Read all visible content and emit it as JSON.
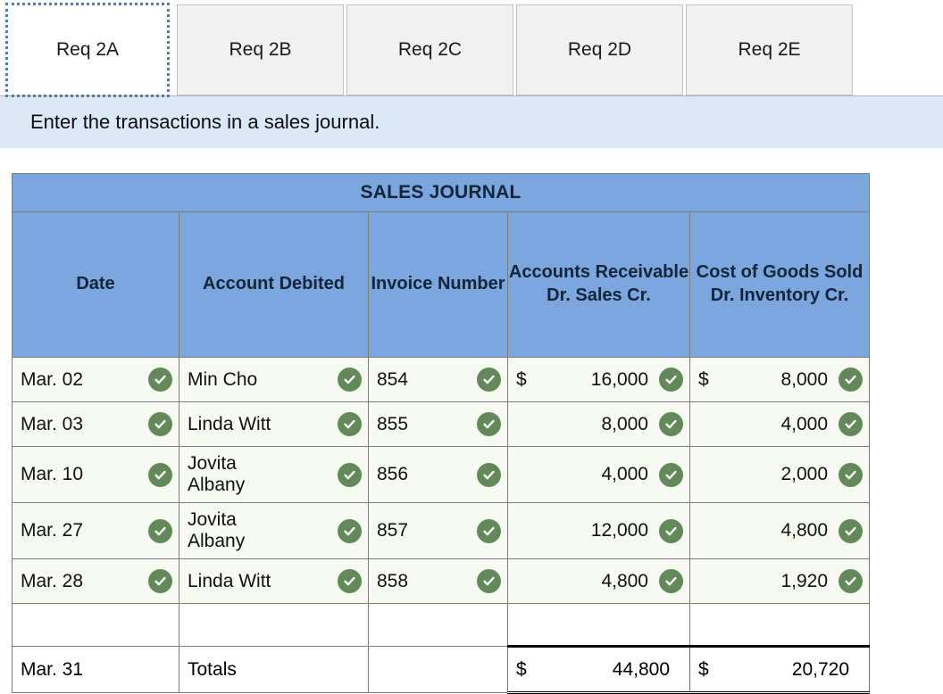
{
  "tabs": [
    {
      "label": "Req 2A",
      "active": true
    },
    {
      "label": "Req 2B",
      "active": false
    },
    {
      "label": "Req 2C",
      "active": false
    },
    {
      "label": "Req 2D",
      "active": false
    },
    {
      "label": "Req 2E",
      "active": false
    }
  ],
  "instruction": "Enter the transactions in a sales journal.",
  "journal": {
    "title": "SALES JOURNAL",
    "columns": [
      "Date",
      "Account\nDebited",
      "Invoice\nNumber",
      "Accounts\nReceivable\nDr. Sales\nCr.",
      "Cost of\nGoods\nSold Dr.\nInventory\nCr."
    ],
    "rows": [
      {
        "date": "Mar. 02",
        "date_ok": true,
        "account": "Min Cho",
        "account_ok": true,
        "invoice": "854",
        "invoice_ok": true,
        "ar_dollar": "$",
        "ar": "16,000",
        "ar_ok": true,
        "cogs_dollar": "$",
        "cogs": "8,000",
        "cogs_ok": true
      },
      {
        "date": "Mar. 03",
        "date_ok": true,
        "account": "Linda Witt",
        "account_ok": true,
        "invoice": "855",
        "invoice_ok": true,
        "ar_dollar": "",
        "ar": "8,000",
        "ar_ok": true,
        "cogs_dollar": "",
        "cogs": "4,000",
        "cogs_ok": true
      },
      {
        "date": "Mar. 10",
        "date_ok": true,
        "account": "Jovita\nAlbany",
        "account_ok": true,
        "invoice": "856",
        "invoice_ok": true,
        "ar_dollar": "",
        "ar": "4,000",
        "ar_ok": true,
        "cogs_dollar": "",
        "cogs": "2,000",
        "cogs_ok": true
      },
      {
        "date": "Mar. 27",
        "date_ok": true,
        "account": "Jovita\nAlbany",
        "account_ok": true,
        "invoice": "857",
        "invoice_ok": true,
        "ar_dollar": "",
        "ar": "12,000",
        "ar_ok": true,
        "cogs_dollar": "",
        "cogs": "4,800",
        "cogs_ok": true
      },
      {
        "date": "Mar. 28",
        "date_ok": true,
        "account": "Linda Witt",
        "account_ok": true,
        "invoice": "858",
        "invoice_ok": true,
        "ar_dollar": "",
        "ar": "4,800",
        "ar_ok": true,
        "cogs_dollar": "",
        "cogs": "1,920",
        "cogs_ok": true
      }
    ],
    "totals": {
      "date": "Mar. 31",
      "label": "Totals",
      "invoice": "",
      "ar_dollar": "$",
      "ar": "44,800",
      "cogs_dollar": "$",
      "cogs": "20,720"
    }
  },
  "colors": {
    "header_blue": "#7ba7de",
    "instruction_blue": "#dbe8f7",
    "check_green": "#63885a",
    "row_bg": "#f7f9f3",
    "tab_inactive": "#f1f1f1",
    "focus_outline": "#4a7ebb"
  },
  "icons": {
    "check": "check-circle-icon"
  }
}
